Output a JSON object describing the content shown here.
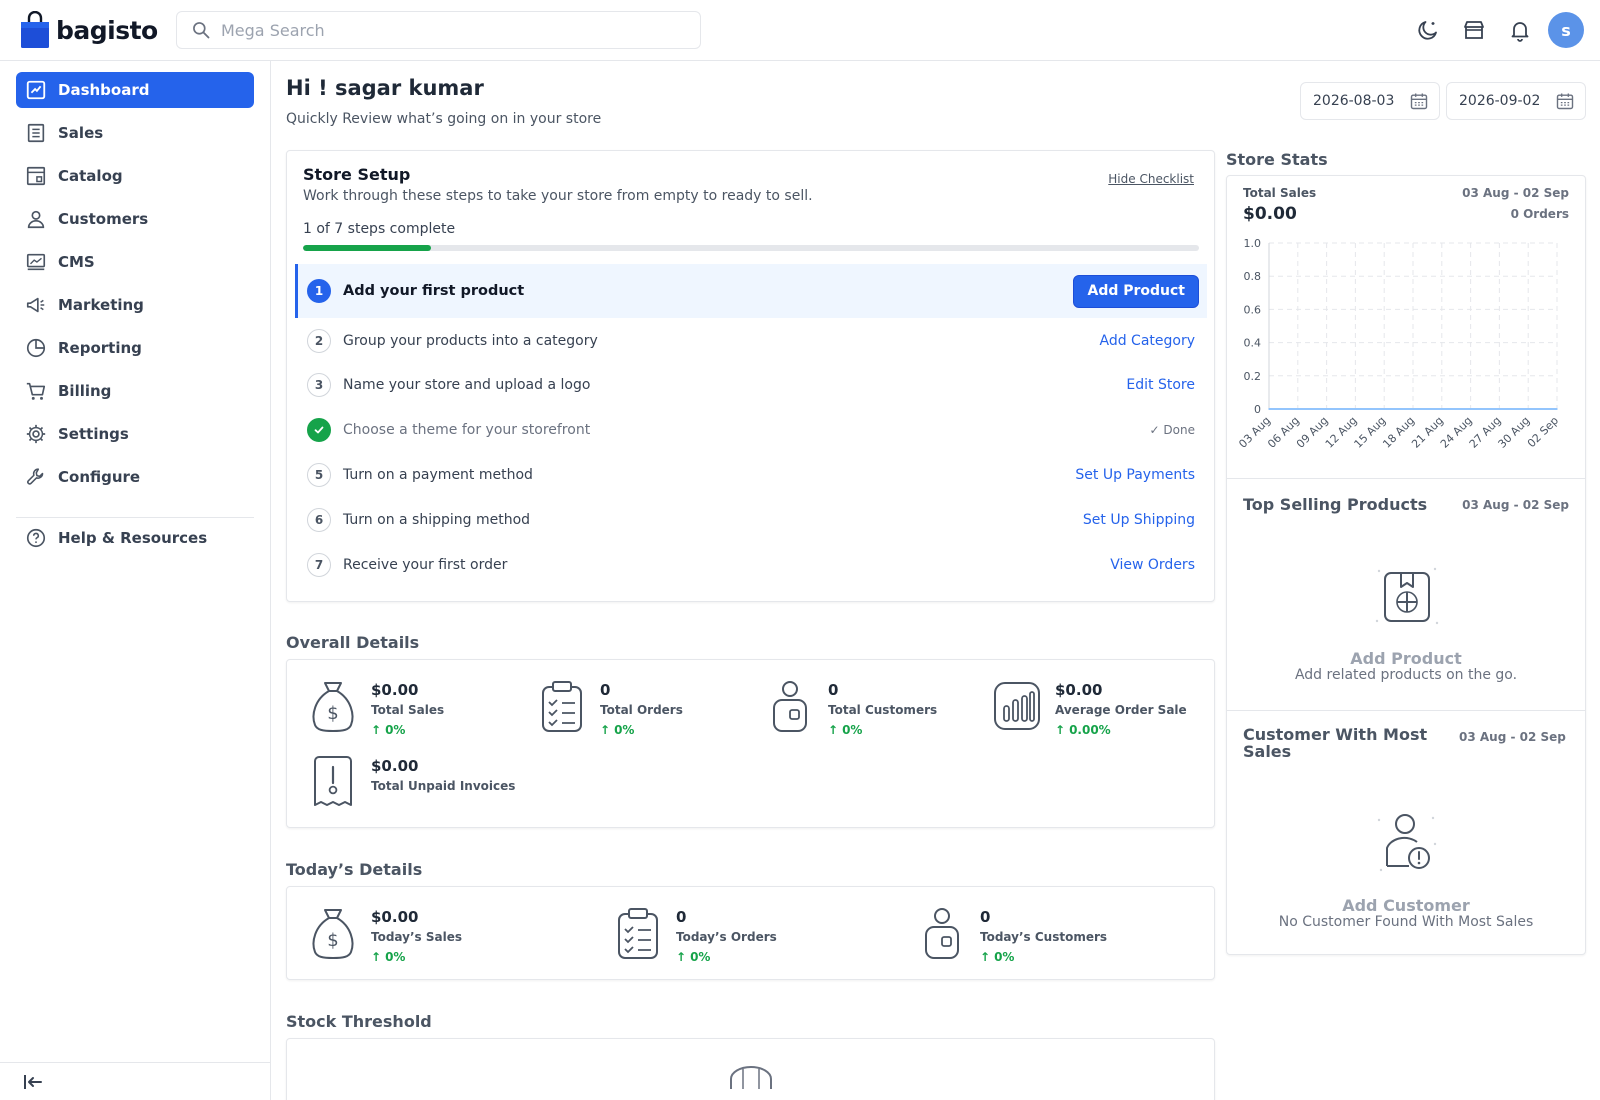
{
  "brand": {
    "name": "bagisto",
    "accent": "#2563eb",
    "success": "#16a34a"
  },
  "search": {
    "placeholder": "Mega Search"
  },
  "header_icons": [
    "moon-icon",
    "store-icon",
    "bell-icon"
  ],
  "user": {
    "initial": "s"
  },
  "sidebar": {
    "items": [
      {
        "label": "Dashboard",
        "icon": "dashboard-icon",
        "active": true
      },
      {
        "label": "Sales",
        "icon": "receipt-icon"
      },
      {
        "label": "Catalog",
        "icon": "catalog-icon"
      },
      {
        "label": "Customers",
        "icon": "user-icon"
      },
      {
        "label": "CMS",
        "icon": "cms-icon"
      },
      {
        "label": "Marketing",
        "icon": "megaphone-icon"
      },
      {
        "label": "Reporting",
        "icon": "pie-chart-icon"
      },
      {
        "label": "Billing",
        "icon": "cart-icon"
      },
      {
        "label": "Settings",
        "icon": "gear-icon"
      },
      {
        "label": "Configure",
        "icon": "wrench-icon"
      }
    ],
    "help": {
      "label": "Help & Resources",
      "icon": "help-circle-icon"
    }
  },
  "greeting": {
    "title": "Hi ! sagar kumar",
    "subtitle": "Quickly Review what’s going on in your store"
  },
  "date_range": {
    "start": "2026-08-03",
    "end": "2026-09-02"
  },
  "store_setup": {
    "title": "Store Setup",
    "description": "Work through these steps to take your store from empty to ready to sell.",
    "hide_label": "Hide Checklist",
    "progress_text": "1 of 7 steps complete",
    "progress_fraction": 0.142857,
    "steps": [
      {
        "num": "1",
        "label": "Add your first product",
        "action": "Add Product",
        "state": "active"
      },
      {
        "num": "2",
        "label": "Group your products into a category",
        "action": "Add Category",
        "state": "todo"
      },
      {
        "num": "3",
        "label": "Name your store and upload a logo",
        "action": "Edit Store",
        "state": "todo"
      },
      {
        "num": "4",
        "label": "Choose a theme for your storefront",
        "action": "✓ Done",
        "state": "done"
      },
      {
        "num": "5",
        "label": "Turn on a payment method",
        "action": "Set Up Payments",
        "state": "todo"
      },
      {
        "num": "6",
        "label": "Turn on a shipping method",
        "action": "Set Up Shipping",
        "state": "todo"
      },
      {
        "num": "7",
        "label": "Receive your first order",
        "action": "View Orders",
        "state": "todo"
      }
    ]
  },
  "overall": {
    "title": "Overall Details",
    "stats": [
      {
        "value": "$0.00",
        "label": "Total Sales",
        "pct": "0%",
        "icon": "money-bag-icon"
      },
      {
        "value": "0",
        "label": "Total Orders",
        "pct": "0%",
        "icon": "clipboard-icon"
      },
      {
        "value": "0",
        "label": "Total Customers",
        "pct": "0%",
        "icon": "customer-icon"
      },
      {
        "value": "$0.00",
        "label": "Average Order Sale",
        "pct": "0.00%",
        "icon": "bar-chart-icon"
      },
      {
        "value": "$0.00",
        "label": "Total Unpaid Invoices",
        "icon": "invoice-alert-icon"
      }
    ]
  },
  "today": {
    "title": "Today’s Details",
    "stats": [
      {
        "value": "$0.00",
        "label": "Today’s Sales",
        "pct": "0%",
        "icon": "money-bag-icon"
      },
      {
        "value": "0",
        "label": "Today’s Orders",
        "pct": "0%",
        "icon": "clipboard-icon"
      },
      {
        "value": "0",
        "label": "Today’s Customers",
        "pct": "0%",
        "icon": "customer-icon"
      }
    ]
  },
  "stock": {
    "title": "Stock Threshold"
  },
  "store_stats": {
    "title": "Store Stats",
    "total_sales_label": "Total Sales",
    "total_sales_value": "$0.00",
    "range": "03 Aug - 02 Sep",
    "orders": "0 Orders"
  },
  "chart_data": {
    "type": "line",
    "x": [
      "03 Aug",
      "06 Aug",
      "09 Aug",
      "12 Aug",
      "15 Aug",
      "18 Aug",
      "21 Aug",
      "24 Aug",
      "27 Aug",
      "30 Aug",
      "02 Sep"
    ],
    "series": [
      {
        "values": [
          0,
          0,
          0,
          0,
          0,
          0,
          0,
          0,
          0,
          0,
          0
        ]
      }
    ],
    "yticks": [
      "0",
      "0.2",
      "0.4",
      "0.6",
      "0.8",
      "1.0"
    ],
    "ylim": [
      0,
      1
    ],
    "grid": true,
    "line_color": "#93c5fd"
  },
  "top_selling": {
    "title": "Top Selling Products",
    "range": "03 Aug - 02 Sep",
    "empty_title": "Add Product",
    "empty_desc": "Add related products on the go."
  },
  "top_customers": {
    "title": "Customer With Most Sales",
    "range": "03 Aug - 02 Sep",
    "empty_title": "Add Customer",
    "empty_desc": "No Customer Found With Most Sales"
  }
}
